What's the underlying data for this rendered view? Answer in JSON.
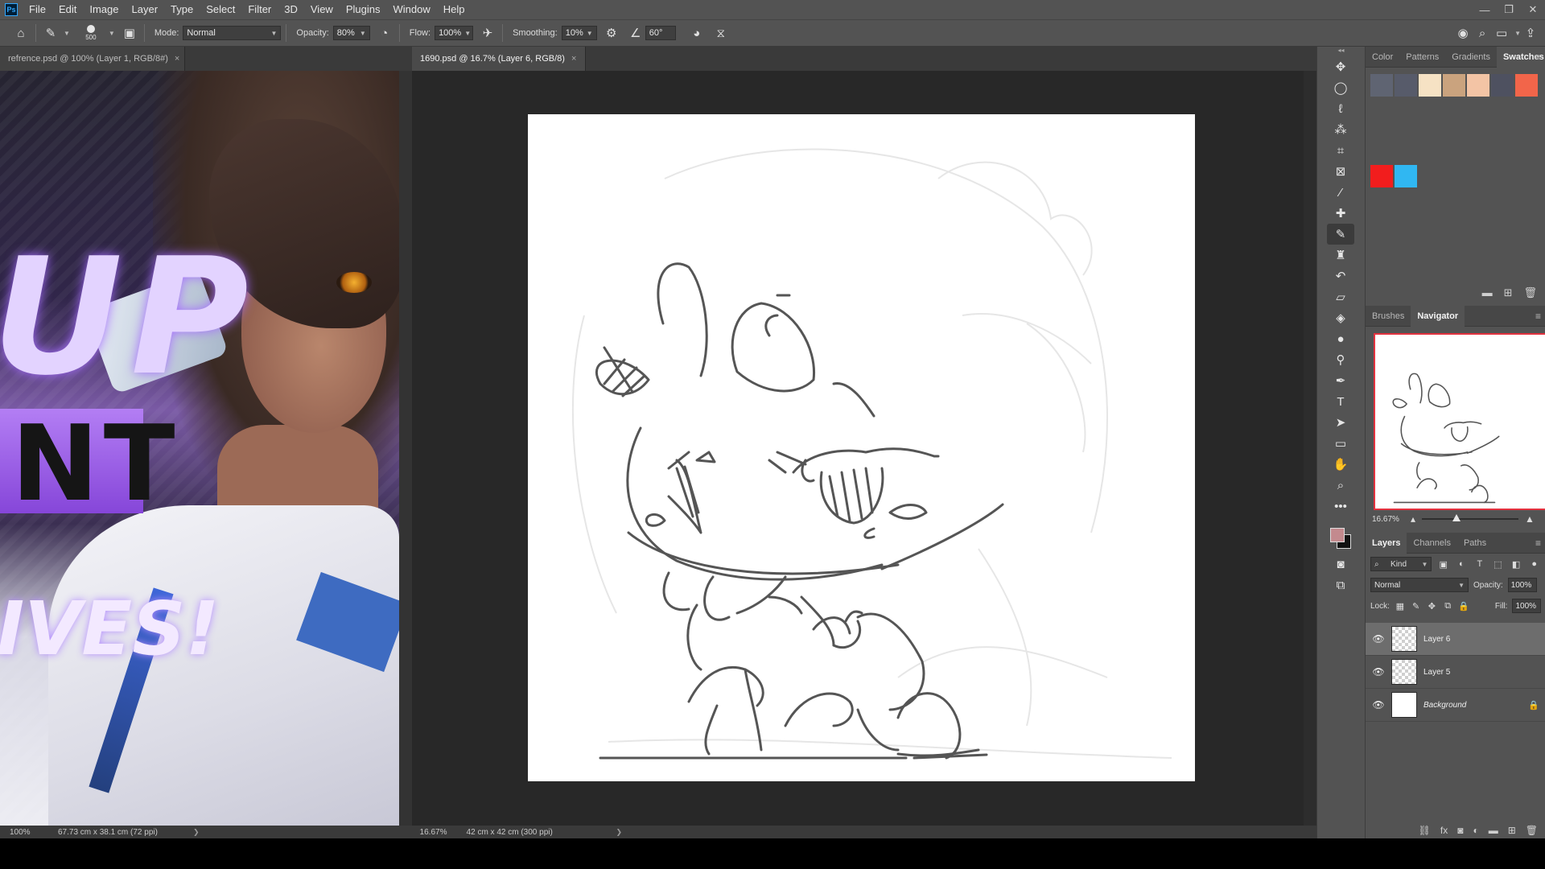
{
  "app": {
    "logo": "Ps"
  },
  "menu": [
    "File",
    "Edit",
    "Image",
    "Layer",
    "Type",
    "Select",
    "Filter",
    "3D",
    "View",
    "Plugins",
    "Window",
    "Help"
  ],
  "window_controls": {
    "minimize": "—",
    "restore": "❐",
    "close": "✕"
  },
  "options_bar": {
    "brush_size": "500",
    "mode_label": "Mode:",
    "mode_value": "Normal",
    "opacity_label": "Opacity:",
    "opacity_value": "80%",
    "flow_label": "Flow:",
    "flow_value": "100%",
    "smoothing_label": "Smoothing:",
    "smoothing_value": "10%",
    "angle_value": "60°"
  },
  "documents": [
    {
      "title": "refrence.psd @ 100% (Layer 1, RGB/8#)",
      "active": false
    },
    {
      "title": "1690.psd @ 16.7% (Layer 6, RGB/8)",
      "active": true
    }
  ],
  "reference_art_text": {
    "line1": "UP",
    "line2": "NT",
    "line3": "IVES!"
  },
  "status": {
    "left_zoom": "100%",
    "left_info": "67.73 cm x 38.1 cm (72 ppi)",
    "right_zoom": "16.67%",
    "right_info": "42 cm x 42 cm (300 ppi)"
  },
  "toolbar": {
    "tools": [
      "move-icon",
      "marquee-icon",
      "lasso-icon",
      "magic-wand-icon",
      "crop-icon",
      "frame-icon",
      "eyedropper-icon",
      "healing-icon",
      "brush-icon",
      "stamp-icon",
      "history-brush-icon",
      "eraser-icon",
      "bucket-icon",
      "blur-icon",
      "dodge-icon",
      "pen-icon",
      "type-icon",
      "path-select-icon",
      "rectangle-icon",
      "hand-icon",
      "zoom-icon",
      "more-icon"
    ],
    "foreground_color": "#c38a8e",
    "background_color": "#111111"
  },
  "swatches_panel": {
    "tabs": [
      "Color",
      "Patterns",
      "Gradients",
      "Swatches"
    ],
    "active_tab": "Swatches",
    "colors": [
      "#5f6472",
      "#575b6a",
      "#f6e2c4",
      "#caa37e",
      "#f3c4a5",
      "#4e5160",
      "#f2654a",
      "#f21d1d",
      "#30b7f2"
    ]
  },
  "navigator_panel": {
    "tabs": [
      "Brushes",
      "Navigator"
    ],
    "active_tab": "Navigator",
    "zoom": "16.67%",
    "zoom_fraction": 0.36
  },
  "layers_panel": {
    "tabs": [
      "Layers",
      "Channels",
      "Paths"
    ],
    "active_tab": "Layers",
    "filter_kind": "Kind",
    "blend_mode": "Normal",
    "opacity_label": "Opacity:",
    "opacity_value": "100%",
    "lock_label": "Lock:",
    "fill_label": "Fill:",
    "fill_value": "100%",
    "layers": [
      {
        "name": "Layer 6",
        "selected": true,
        "visible": true,
        "locked": false
      },
      {
        "name": "Layer 5",
        "selected": false,
        "visible": true,
        "locked": false
      },
      {
        "name": "Background",
        "selected": false,
        "visible": true,
        "locked": true
      }
    ]
  }
}
